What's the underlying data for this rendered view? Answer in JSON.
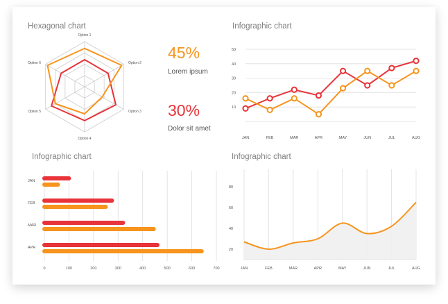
{
  "colors": {
    "red": "#e8333a",
    "orange": "#f7941d",
    "grid": "#cccccc",
    "text": "#555555",
    "title": "#808080",
    "area_fill": "#efefef"
  },
  "radar": {
    "title": "Hexagonal chart",
    "options": [
      "Option 1",
      "Option 2",
      "Option 3",
      "Option 4",
      "Option 5",
      "Option 6"
    ],
    "series": [
      {
        "color": "red",
        "values": [
          0.6,
          0.6,
          0.8,
          0.75,
          0.85,
          0.6
        ]
      },
      {
        "color": "orange",
        "values": [
          0.85,
          0.95,
          0.45,
          0.6,
          0.75,
          0.95
        ]
      }
    ]
  },
  "stats": [
    {
      "value": "45%",
      "label": "Lorem ipsum",
      "color": "orange"
    },
    {
      "value": "30%",
      "label": "Dolor sit amet",
      "color": "red"
    }
  ],
  "chart_data": [
    {
      "type": "radar",
      "title": "Hexagonal chart",
      "categories": [
        "Option 1",
        "Option 2",
        "Option 3",
        "Option 4",
        "Option 5",
        "Option 6"
      ],
      "series": [
        {
          "values": [
            0.6,
            0.6,
            0.8,
            0.75,
            0.85,
            0.6
          ]
        },
        {
          "values": [
            0.85,
            0.95,
            0.45,
            0.6,
            0.75,
            0.95
          ]
        }
      ]
    },
    {
      "type": "line",
      "title": "Infographic chart",
      "categories": [
        "JAN",
        "FEB",
        "MAR",
        "APR",
        "MAY",
        "JUN",
        "JUL",
        "AUG"
      ],
      "yticks": [
        10,
        20,
        30,
        40,
        50
      ],
      "ylim": [
        0,
        50
      ],
      "series": [
        {
          "color": "red",
          "values": [
            9,
            16,
            22,
            18,
            35,
            25,
            37,
            42
          ]
        },
        {
          "color": "orange",
          "values": [
            16,
            8,
            16,
            5,
            23,
            35,
            25,
            35
          ]
        }
      ]
    },
    {
      "type": "bar",
      "orientation": "horizontal",
      "title": "Infographic chart",
      "categories": [
        "JAN",
        "FEB",
        "MAR",
        "APR"
      ],
      "xticks": [
        0,
        100,
        200,
        300,
        400,
        500,
        600,
        700
      ],
      "xlim": [
        0,
        700
      ],
      "series": [
        {
          "color": "red",
          "values": [
            100,
            275,
            320,
            460
          ]
        },
        {
          "color": "orange",
          "values": [
            55,
            250,
            445,
            640
          ]
        }
      ]
    },
    {
      "type": "area",
      "title": "Infographic chart",
      "categories": [
        "JAN",
        "FEB",
        "MAR",
        "APR",
        "MAY",
        "JUN",
        "JUL",
        "AUG"
      ],
      "yticks": [
        20,
        40,
        60,
        80
      ],
      "ylim": [
        10,
        90
      ],
      "series": [
        {
          "color": "orange",
          "values": [
            27,
            20,
            26,
            30,
            45,
            35,
            42,
            65
          ]
        }
      ]
    }
  ]
}
